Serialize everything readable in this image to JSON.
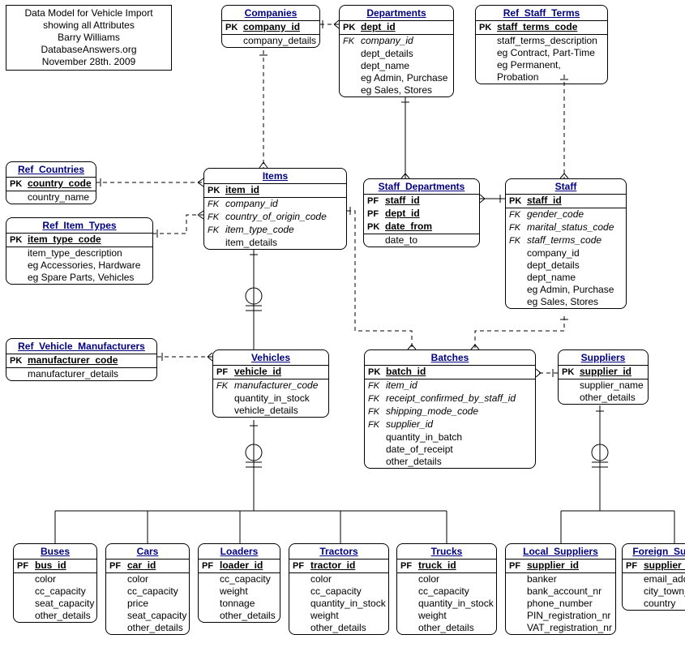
{
  "note": {
    "line1": "Data Model for Vehicle Import",
    "line2": "showing all Attributes",
    "line3": "Barry Williams",
    "line4": "DatabaseAnswers.org",
    "line5": "November 28th. 2009"
  },
  "entities": {
    "companies": {
      "title": "Companies",
      "r0": {
        "k": "PK",
        "a": "company_id"
      },
      "r1": {
        "k": "",
        "a": "company_details"
      }
    },
    "departments": {
      "title": "Departments",
      "r0": {
        "k": "PK",
        "a": "dept_id"
      },
      "r1": {
        "k": "FK",
        "a": "company_id"
      },
      "r2": {
        "k": "",
        "a": "dept_details"
      },
      "r3": {
        "k": "",
        "a": "dept_name"
      },
      "r4": {
        "k": "",
        "a": "eg Admin, Purchase"
      },
      "r5": {
        "k": "",
        "a": "eg Sales, Stores"
      }
    },
    "ref_staff_terms": {
      "title": "Ref_Staff_Terms",
      "r0": {
        "k": "PK",
        "a": "staff_terms_code"
      },
      "r1": {
        "k": "",
        "a": "staff_terms_description"
      },
      "r2": {
        "k": "",
        "a": "eg Contract, Part-Time"
      },
      "r3": {
        "k": "",
        "a": "eg Permanent, Probation"
      }
    },
    "ref_countries": {
      "title": "Ref_Countries",
      "r0": {
        "k": "PK",
        "a": "country_code"
      },
      "r1": {
        "k": "",
        "a": "country_name"
      }
    },
    "ref_item_types": {
      "title": "Ref_Item_Types",
      "r0": {
        "k": "PK",
        "a": "item_type_code"
      },
      "r1": {
        "k": "",
        "a": "item_type_description"
      },
      "r2": {
        "k": "",
        "a": "eg Accessories, Hardware"
      },
      "r3": {
        "k": "",
        "a": "eg Spare Parts, Vehicles"
      }
    },
    "items": {
      "title": "Items",
      "r0": {
        "k": "PK",
        "a": "item_id"
      },
      "r1": {
        "k": "FK",
        "a": "company_id"
      },
      "r2": {
        "k": "FK",
        "a": "country_of_origin_code"
      },
      "r3": {
        "k": "FK",
        "a": "item_type_code"
      },
      "r4": {
        "k": "",
        "a": "item_details"
      }
    },
    "staff_departments": {
      "title": "Staff_Departments",
      "r0": {
        "k": "PF",
        "a": "staff_id"
      },
      "r1": {
        "k": "PF",
        "a": "dept_id"
      },
      "r2": {
        "k": "PK",
        "a": "date_from"
      },
      "r3": {
        "k": "",
        "a": "date_to"
      }
    },
    "staff": {
      "title": "Staff",
      "r0": {
        "k": "PK",
        "a": "staff_id"
      },
      "r1": {
        "k": "FK",
        "a": "gender_code"
      },
      "r2": {
        "k": "FK",
        "a": "marital_status_code"
      },
      "r3": {
        "k": "FK",
        "a": "staff_terms_code"
      },
      "r4": {
        "k": "",
        "a": "company_id"
      },
      "r5": {
        "k": "",
        "a": "dept_details"
      },
      "r6": {
        "k": "",
        "a": "dept_name"
      },
      "r7": {
        "k": "",
        "a": "eg Admin, Purchase"
      },
      "r8": {
        "k": "",
        "a": "eg Sales, Stores"
      }
    },
    "ref_vehicle_manufacturers": {
      "title": "Ref_Vehicle_Manufacturers",
      "r0": {
        "k": "PK",
        "a": "manufacturer_code"
      },
      "r1": {
        "k": "",
        "a": "manufacturer_details"
      }
    },
    "vehicles": {
      "title": "Vehicles",
      "r0": {
        "k": "PF",
        "a": "vehicle_id"
      },
      "r1": {
        "k": "FK",
        "a": "manufacturer_code"
      },
      "r2": {
        "k": "",
        "a": "quantity_in_stock"
      },
      "r3": {
        "k": "",
        "a": "vehicle_details"
      }
    },
    "batches": {
      "title": "Batches",
      "r0": {
        "k": "PK",
        "a": "batch_id"
      },
      "r1": {
        "k": "FK",
        "a": "item_id"
      },
      "r2": {
        "k": "FK",
        "a": "receipt_confirmed_by_staff_id"
      },
      "r3": {
        "k": "FK",
        "a": "shipping_mode_code"
      },
      "r4": {
        "k": "FK",
        "a": "supplier_id"
      },
      "r5": {
        "k": "",
        "a": "quantity_in_batch"
      },
      "r6": {
        "k": "",
        "a": "date_of_receipt"
      },
      "r7": {
        "k": "",
        "a": "other_details"
      }
    },
    "suppliers": {
      "title": "Suppliers",
      "r0": {
        "k": "PK",
        "a": "supplier_id"
      },
      "r1": {
        "k": "",
        "a": "supplier_name"
      },
      "r2": {
        "k": "",
        "a": "other_details"
      }
    },
    "buses": {
      "title": "Buses",
      "r0": {
        "k": "PF",
        "a": "bus_id"
      },
      "r1": {
        "k": "",
        "a": "color"
      },
      "r2": {
        "k": "",
        "a": "cc_capacity"
      },
      "r3": {
        "k": "",
        "a": "seat_capacity"
      },
      "r4": {
        "k": "",
        "a": "other_details"
      }
    },
    "cars": {
      "title": "Cars",
      "r0": {
        "k": "PF",
        "a": "car_id"
      },
      "r1": {
        "k": "",
        "a": "color"
      },
      "r2": {
        "k": "",
        "a": "cc_capacity"
      },
      "r3": {
        "k": "",
        "a": "price"
      },
      "r4": {
        "k": "",
        "a": "seat_capacity"
      },
      "r5": {
        "k": "",
        "a": "other_details"
      }
    },
    "loaders": {
      "title": "Loaders",
      "r0": {
        "k": "PF",
        "a": "loader_id"
      },
      "r1": {
        "k": "",
        "a": "cc_capacity"
      },
      "r2": {
        "k": "",
        "a": "weight"
      },
      "r3": {
        "k": "",
        "a": "tonnage"
      },
      "r4": {
        "k": "",
        "a": "other_details"
      }
    },
    "tractors": {
      "title": "Tractors",
      "r0": {
        "k": "PF",
        "a": "tractor_id"
      },
      "r1": {
        "k": "",
        "a": "color"
      },
      "r2": {
        "k": "",
        "a": "cc_capacity"
      },
      "r3": {
        "k": "",
        "a": "quantity_in_stock"
      },
      "r4": {
        "k": "",
        "a": "weight"
      },
      "r5": {
        "k": "",
        "a": "other_details"
      }
    },
    "trucks": {
      "title": "Trucks",
      "r0": {
        "k": "PF",
        "a": "truck_id"
      },
      "r1": {
        "k": "",
        "a": "color"
      },
      "r2": {
        "k": "",
        "a": "cc_capacity"
      },
      "r3": {
        "k": "",
        "a": "quantity_in_stock"
      },
      "r4": {
        "k": "",
        "a": "weight"
      },
      "r5": {
        "k": "",
        "a": "other_details"
      }
    },
    "local_suppliers": {
      "title": "Local_Suppliers",
      "r0": {
        "k": "PF",
        "a": "supplier_id"
      },
      "r1": {
        "k": "",
        "a": "banker"
      },
      "r2": {
        "k": "",
        "a": "bank_account_nr"
      },
      "r3": {
        "k": "",
        "a": "phone_number"
      },
      "r4": {
        "k": "",
        "a": "PIN_registration_nr"
      },
      "r5": {
        "k": "",
        "a": "VAT_registration_nr"
      }
    },
    "foreign_suppliers": {
      "title": "Foreign_Suppliers",
      "r0": {
        "k": "PF",
        "a": "supplier_id"
      },
      "r1": {
        "k": "",
        "a": "email_address"
      },
      "r2": {
        "k": "",
        "a": "city_town_location"
      },
      "r3": {
        "k": "",
        "a": "country"
      }
    }
  }
}
